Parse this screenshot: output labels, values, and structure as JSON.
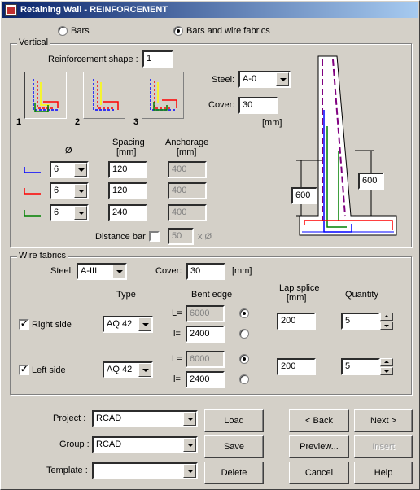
{
  "window": {
    "title": "Retaining Wall - REINFORCEMENT",
    "icon": "app-icon"
  },
  "mode": {
    "options": [
      {
        "label": "Bars",
        "selected": false
      },
      {
        "label": "Bars and wire fabrics",
        "selected": true
      }
    ]
  },
  "vertical": {
    "title": "Vertical",
    "shape_label": "Reinforcement shape :",
    "shape_value": "1",
    "shape_numbers": [
      "1",
      "2",
      "3"
    ],
    "steel_label": "Steel:",
    "steel_value": "A-0",
    "cover_label": "Cover:",
    "cover_value": "30",
    "cover_unit": "[mm]",
    "diam_header": "Ø",
    "spacing_header": "Spacing",
    "spacing_unit": "[mm]",
    "anchorage_header": "Anchorage",
    "anchorage_unit": "[mm]",
    "rows": [
      {
        "color": "#0000ff",
        "diameter": "6",
        "spacing": "120",
        "anchorage": "400"
      },
      {
        "color": "#ff0000",
        "diameter": "6",
        "spacing": "120",
        "anchorage": "400"
      },
      {
        "color": "#008000",
        "diameter": "6",
        "spacing": "240",
        "anchorage": "400"
      }
    ],
    "distance_bar_label": "Distance bar",
    "distance_bar_checked": false,
    "distance_bar_value": "50",
    "distance_bar_unit": "x Ø",
    "dim_left": "600",
    "dim_right": "600"
  },
  "wire": {
    "title": "Wire fabrics",
    "steel_label": "Steel:",
    "steel_value": "A-III",
    "cover_label": "Cover:",
    "cover_value": "30",
    "cover_unit": "[mm]",
    "type_header": "Type",
    "bent_header": "Bent edge",
    "lap_header": "Lap splice",
    "lap_unit": "[mm]",
    "qty_header": "Quantity",
    "L_label": "L=",
    "l_label": "l=",
    "right": {
      "label": "Right side",
      "checked": true,
      "type": "AQ 42",
      "L": "6000",
      "l": "2400",
      "L_selected": true,
      "lap": "200",
      "qty": "5"
    },
    "left": {
      "label": "Left side",
      "checked": true,
      "type": "AQ 42",
      "L": "6000",
      "l": "2400",
      "L_selected": true,
      "lap": "200",
      "qty": "5"
    }
  },
  "footer": {
    "project_label": "Project :",
    "project_value": "RCAD",
    "group_label": "Group :",
    "group_value": "RCAD",
    "template_label": "Template :",
    "template_value": "",
    "load": "Load",
    "save": "Save",
    "delete": "Delete",
    "back": "< Back",
    "next": "Next >",
    "preview": "Preview...",
    "insert": "Insert",
    "cancel": "Cancel",
    "help": "Help"
  }
}
